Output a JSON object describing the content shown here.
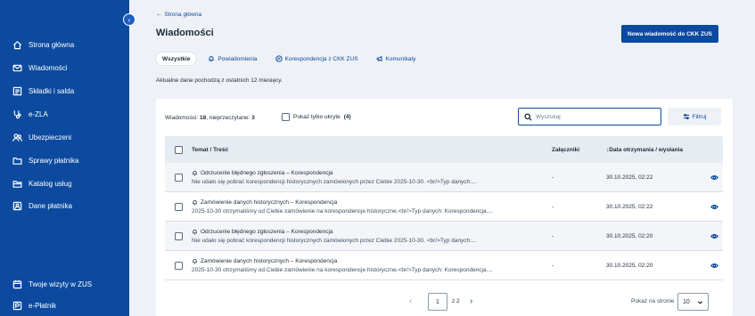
{
  "sidebar": {
    "items": [
      {
        "label": "Strona główna",
        "icon": "home-icon"
      },
      {
        "label": "Wiadomości",
        "icon": "mail-icon"
      },
      {
        "label": "Składki i salda",
        "icon": "receipt-icon"
      },
      {
        "label": "e-ZLA",
        "icon": "stethoscope-icon"
      },
      {
        "label": "Ubezpieczeni",
        "icon": "people-icon"
      },
      {
        "label": "Sprawy płatnika",
        "icon": "folder-icon"
      },
      {
        "label": "Katalog usług",
        "icon": "folder-open-icon"
      },
      {
        "label": "Dane płatnika",
        "icon": "id-card-icon"
      }
    ],
    "bottom_items": [
      {
        "label": "Twoje wizyty w ZUS",
        "icon": "calendar-icon"
      },
      {
        "label": "e-Płatnik",
        "icon": "payer-icon"
      }
    ]
  },
  "header": {
    "back_link": "Strona główna",
    "title": "Wiadomości",
    "new_message_button": "Nowa wiadomość do CKK ZUS"
  },
  "tabs": [
    {
      "label": "Wszystkie",
      "active": true
    },
    {
      "label": "Powiadomienia",
      "icon": "bell-icon"
    },
    {
      "label": "Korespondencja z CKK ZUS",
      "icon": "correspondence-icon"
    },
    {
      "label": "Komunikaty",
      "icon": "megaphone-icon"
    }
  ],
  "info_text": "Aktualne dane pochodzą z ostatnich 12 miesięcy.",
  "summary": {
    "prefix": "Wiadomości: ",
    "total": "18",
    "mid": ", nieprzeczytane: ",
    "unread": "3"
  },
  "only_hidden": {
    "label": "Pokaż tylko ukryte",
    "count": "(4)"
  },
  "search": {
    "placeholder": "Wyszukaj"
  },
  "filter_button": "Filtruj",
  "table": {
    "headers": {
      "topic": "Temat / Treść",
      "attachments": "Załączniki",
      "date": "↓Data otrzymania / wysłania"
    },
    "rows": [
      {
        "title": "Odrzucenie błędnego zgłoszenia – Korespondencja",
        "desc": "Nie udało się pobrać korespondencji historycznych zamówionych przez Ciebie 2025-10-30. <br/>Typ danych:...",
        "attachments": "-",
        "date": "30.10.2025, 02:22"
      },
      {
        "title": "Zamówienie danych historycznych – Korespondencja",
        "desc": "2025-10-30 otrzymaliśmy od Ciebie zamówienie na korespondencje historyczne.<br/>Typ danych: Korespondencja....",
        "attachments": "-",
        "date": "30.10.2025, 02:22"
      },
      {
        "title": "Odrzucenie błędnego zgłoszenia – Korespondencja",
        "desc": "Nie udało się pobrać korespondencji historycznych zamówionych przez Ciebie 2025-10-30. <br/>Typ danych:...",
        "attachments": "-",
        "date": "30.10.2025, 02:20"
      },
      {
        "title": "Zamówienie danych historycznych – Korespondencja",
        "desc": "2025-10-30 otrzymaliśmy od Ciebie zamówienie na korespondencje historyczne.<br/>Typ danych: Korespondencja....",
        "attachments": "-",
        "date": "30.10.2025, 02:20"
      }
    ]
  },
  "pagination": {
    "current_page": "1",
    "of_label": "z 2",
    "page_size_label": "Pokaż na stronie",
    "page_size": "10"
  },
  "colors": {
    "sidebar": "#0b4a9e",
    "accent": "#0b4a9e",
    "background": "#eef1f5"
  }
}
